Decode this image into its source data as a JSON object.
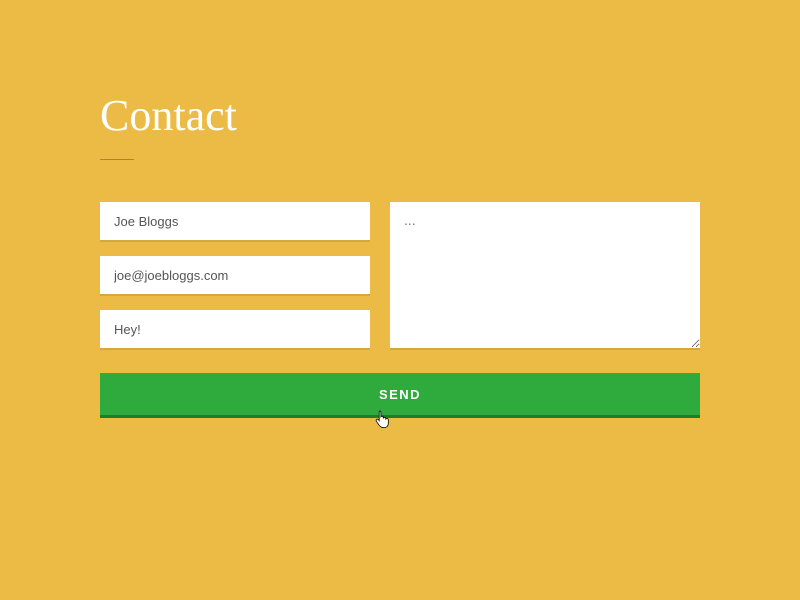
{
  "heading": "Contact",
  "form": {
    "name": {
      "value": "Joe Bloggs"
    },
    "email": {
      "value": "joe@joebloggs.com"
    },
    "subject": {
      "value": "Hey!"
    },
    "message": {
      "value": "..."
    },
    "submit_label": "SEND"
  },
  "colors": {
    "background": "#ebbb45",
    "button": "#2faa3c",
    "button_shadow": "#1e7d2a"
  }
}
